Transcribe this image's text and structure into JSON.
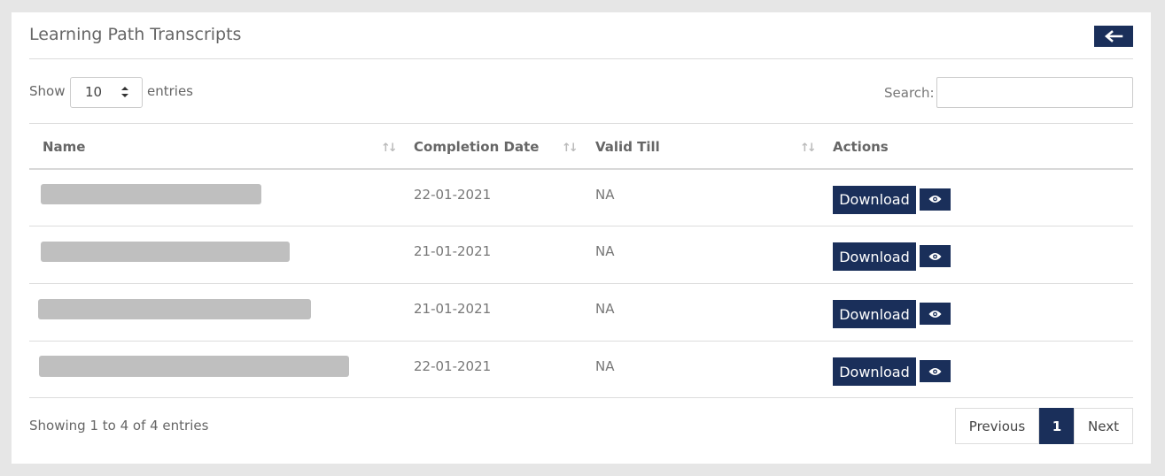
{
  "page": {
    "title": "Learning Path Transcripts"
  },
  "length_menu": {
    "show_label": "Show",
    "value": "10",
    "entries_label": "entries"
  },
  "search": {
    "label": "Search:",
    "value": ""
  },
  "table": {
    "columns": [
      "Name",
      "Completion Date",
      "Valid Till",
      "Actions"
    ],
    "rows": [
      {
        "name": "",
        "completion_date": "22-01-2021",
        "valid_till": "NA",
        "download_label": "Download"
      },
      {
        "name": "",
        "completion_date": "21-01-2021",
        "valid_till": "NA",
        "download_label": "Download"
      },
      {
        "name": "",
        "completion_date": "21-01-2021",
        "valid_till": "NA",
        "download_label": "Download"
      },
      {
        "name": "",
        "completion_date": "22-01-2021",
        "valid_till": "NA",
        "download_label": "Download"
      }
    ]
  },
  "footer": {
    "info": "Showing 1 to 4 of 4 entries",
    "pagination": {
      "previous": "Previous",
      "current": "1",
      "next": "Next"
    }
  },
  "colors": {
    "accent": "#1a2f5a",
    "redaction": "#bfbfbf"
  },
  "icons": {
    "back": "arrow-left-icon",
    "view": "eye-icon",
    "sort": "sort-icon",
    "select_caret": "caret-updown-icon"
  }
}
